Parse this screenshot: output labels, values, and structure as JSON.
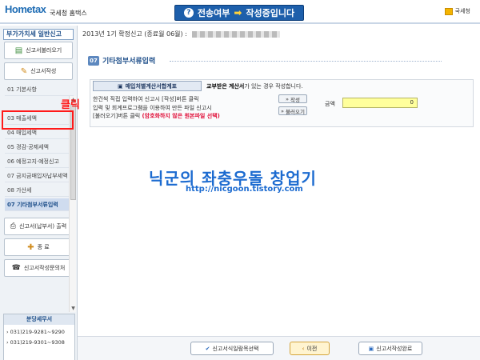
{
  "header": {
    "logo": "Hometax",
    "site_name": "국세청 홈택스",
    "status_prefix": "전송여부",
    "status_text": "작성중입니다",
    "org": "국세청"
  },
  "sidebar": {
    "title": "부가가치세 일반신고",
    "btn_load": "신고서불러오기",
    "btn_write": "신고서작성",
    "items": [
      "01 기본사항",
      "03 매출세액",
      "04 매입세액",
      "05 경감·공제세액",
      "06 예정고지·예정신고",
      "07 금지금매입자납부세액",
      "08 가산세",
      "07 기타첨부서류입력"
    ],
    "btn_print": "신고서(납부서) 출력",
    "btn_end": "종 료",
    "btn_inquiry": "신고서작성문의처",
    "tax_office_title": "분당세무서",
    "phones": [
      "031)219-9281~9290",
      "031)219-9301~9308"
    ],
    "click_label": "클릭"
  },
  "main": {
    "report_line": "2013년 1기 확정신고 (종료월 06월) :",
    "section_num": "07",
    "section_title": "기타첨부서류입력",
    "doc_title": "매입처별계산서합계표",
    "doc_desc_pre": "교부받은",
    "doc_desc_bold": "계산서",
    "doc_desc_post": "가 있는 경우 작성합니다.",
    "line1": "한건씩 직접 입력하여 신고시 [작성]버튼 클릭",
    "line2": "입력 및 회계프로그램을 이용하여 만든 파일 신고시",
    "line3_pre": "[불러오기]버튼 클릭",
    "line3_red": "(암호화하지 않은 원본파일 선택)",
    "btn_write": "작성",
    "btn_load": "불러오기",
    "amount_label": "금액",
    "amount_value": "0"
  },
  "watermark": {
    "title": "닉군의 좌충우돌 창업기",
    "url": "http://nicgoon.tistory.com"
  },
  "bottom": {
    "btn_select": "신고서식일람목선택",
    "btn_prev": "이전",
    "btn_done": "신고서작성완료"
  }
}
